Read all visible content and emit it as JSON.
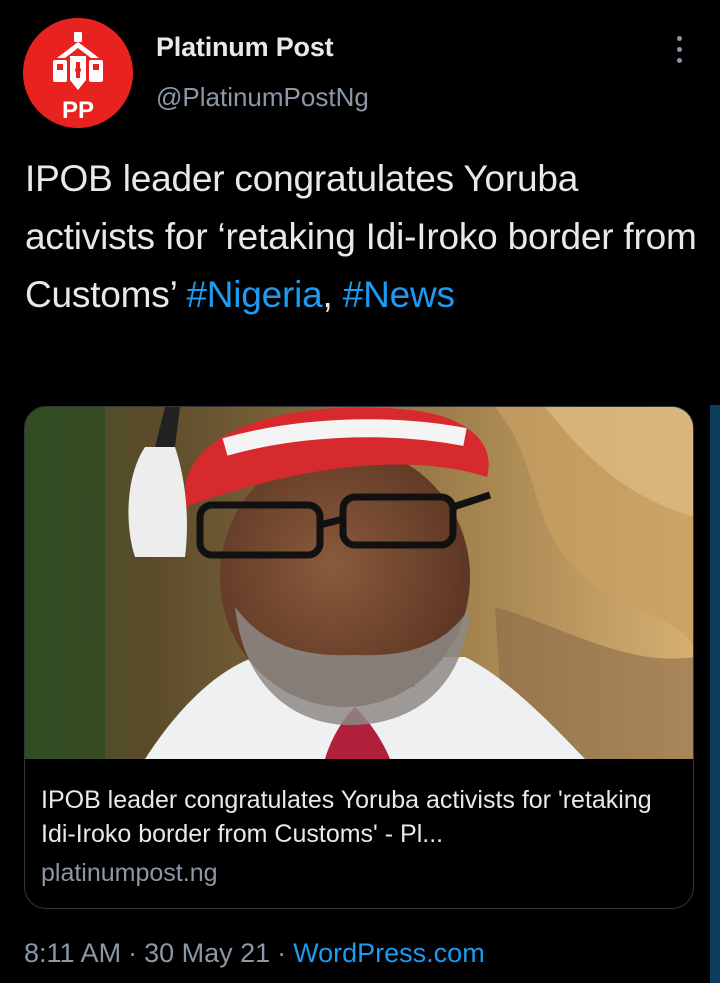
{
  "author": {
    "display_name": "Platinum Post",
    "handle": "@PlatinumPostNg",
    "avatar_text": "PP",
    "avatar_color": "#e8231f"
  },
  "tweet": {
    "text": "IPOB leader congratulates Yoruba activists for ‘retaking Idi-Iroko border from Customs’ ",
    "hashtags": [
      "#Nigeria",
      "#News"
    ],
    "hashtag_separator": ", "
  },
  "card": {
    "image_icon": "portrait-photo",
    "title": "IPOB leader congratulates Yoruba activists for 'retaking Idi-Iroko border from Customs' - Pl...",
    "domain": "platinumpost.ng"
  },
  "meta": {
    "time": "8:11 AM",
    "date": "30 May 21",
    "separator": "·",
    "source": "WordPress.com"
  },
  "icons": {
    "more": "more-vertical-icon"
  },
  "colors": {
    "background": "#000000",
    "text": "#e7e9ea",
    "secondary": "#8b98a5",
    "link": "#1d9bf0"
  }
}
